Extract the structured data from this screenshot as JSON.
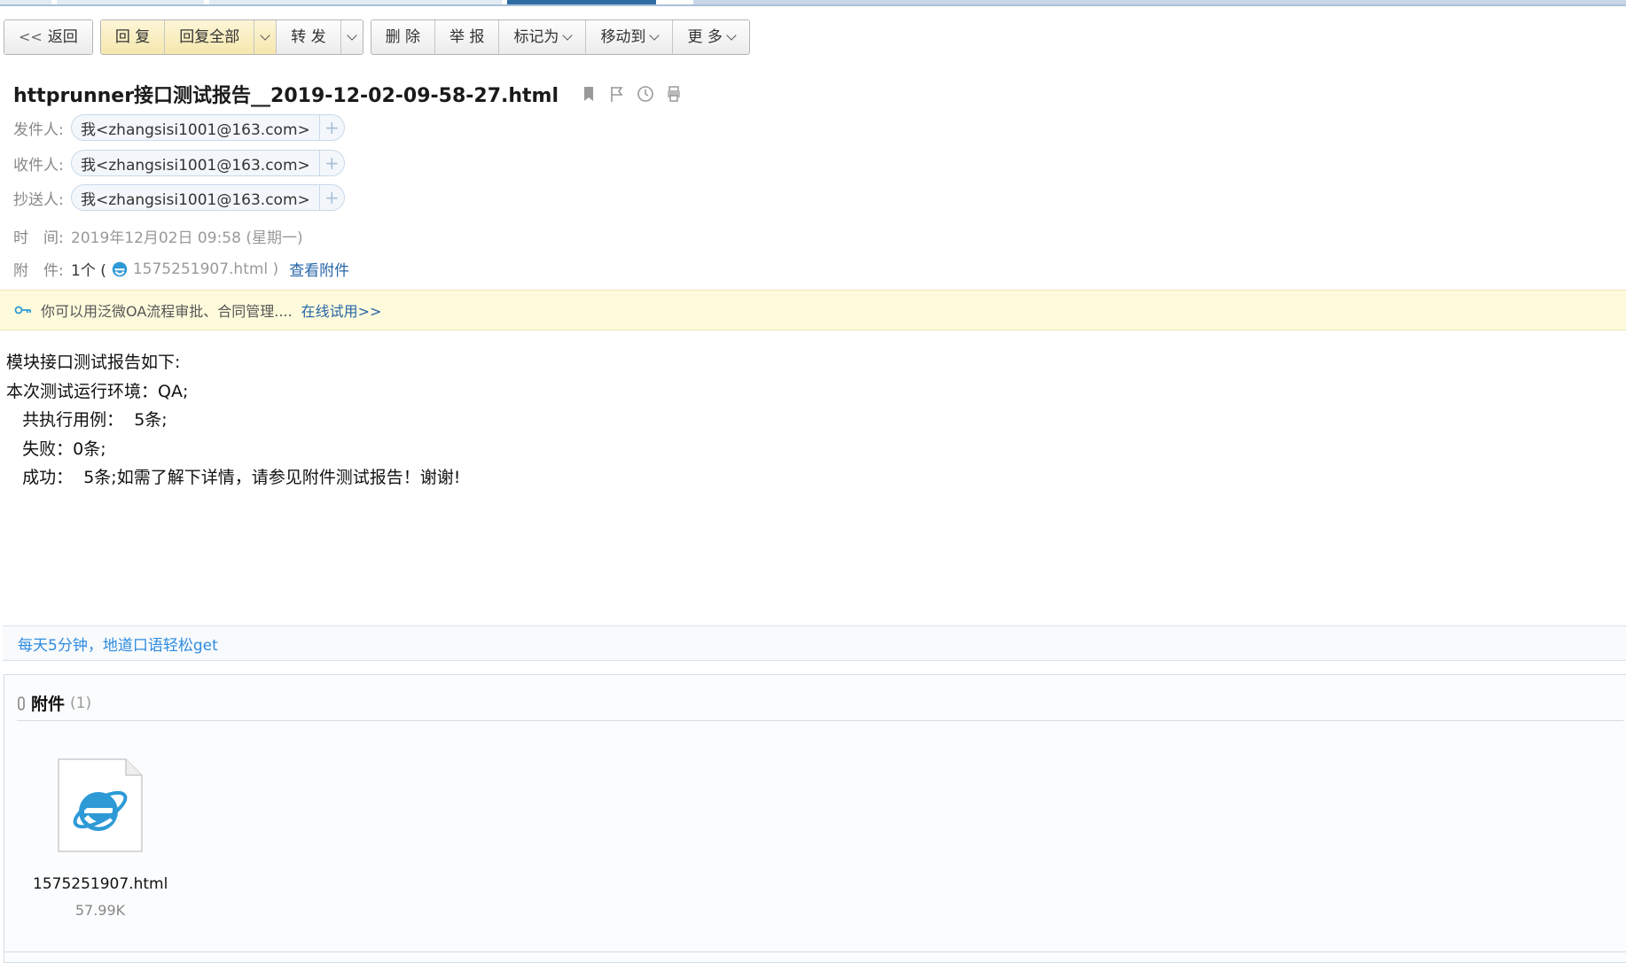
{
  "toolbar": {
    "back": "返回",
    "reply": "回 复",
    "reply_all": "回复全部",
    "forward": "转 发",
    "delete": "删 除",
    "report": "举 报",
    "mark_as": "标记为",
    "move_to": "移动到",
    "more": "更 多"
  },
  "email": {
    "subject": "httprunner接口测试报告__2019-12-02-09-58-27.html",
    "from_label": "发件人:",
    "from": "我<zhangsisi1001@163.com>",
    "to_label": "收件人:",
    "to": "我<zhangsisi1001@163.com>",
    "cc_label": "抄送人:",
    "cc": "我<zhangsisi1001@163.com>",
    "time_label": "时　间:",
    "time": "2019年12月02日 09:58 (星期一)",
    "attach_label": "附　件:",
    "attach_count": "1个 (",
    "attach_file": "1575251907.html )",
    "view_attachments": "查看附件"
  },
  "notice": {
    "text": "你可以用泛微OA流程审批、合同管理....",
    "link": "在线试用>>"
  },
  "body_lines": [
    "模块接口测试报告如下:",
    "",
    "本次测试运行环境：QA;",
    "   共执行用例：  5条;",
    "   失败：0条;",
    "   成功：  5条;如需了解下详情，请参见附件测试报告！谢谢!"
  ],
  "ad": "每天5分钟，地道口语轻松get",
  "attachments": {
    "title": "附件",
    "count": "(1)",
    "file_name": "1575251907.html",
    "file_size": "57.99K"
  },
  "colors": {
    "link": "#2565a7",
    "ad_link": "#2e8be0",
    "ie_blue": "#2d9ad6",
    "active_tab": "#2e6da4"
  }
}
